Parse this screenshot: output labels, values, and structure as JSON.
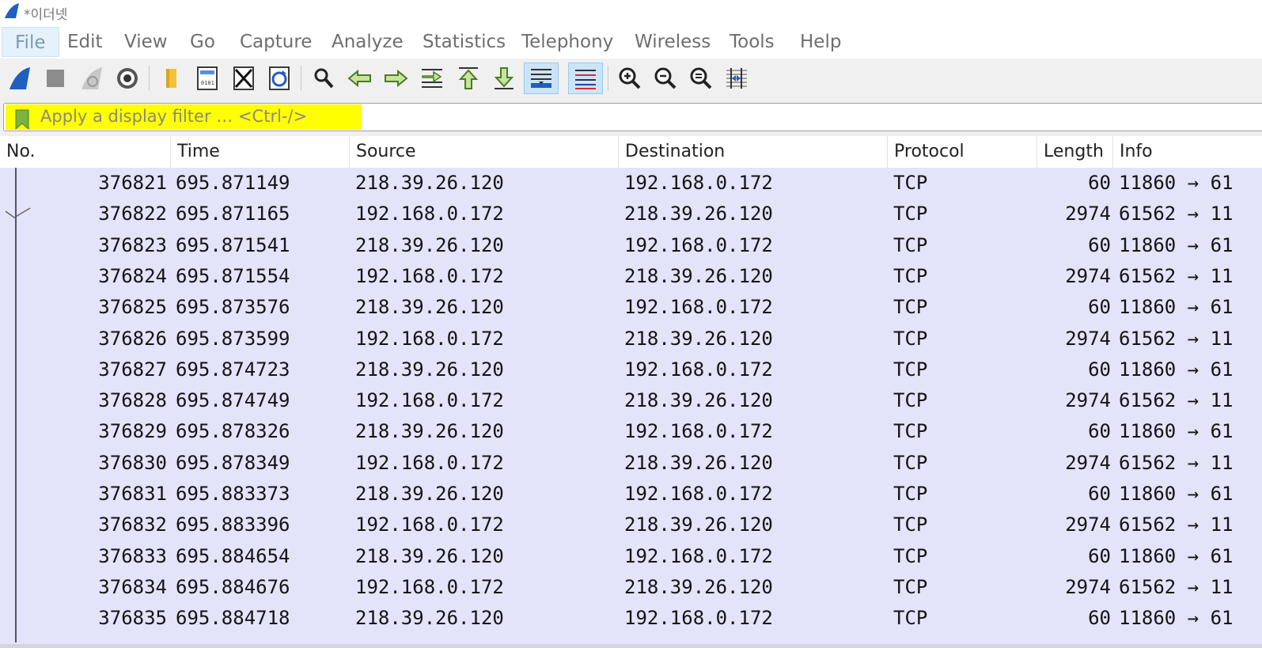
{
  "window": {
    "title": "*이더넷"
  },
  "menu": {
    "items": [
      "File",
      "Edit",
      "View",
      "Go",
      "Capture",
      "Analyze",
      "Statistics",
      "Telephony",
      "Wireless",
      "Tools",
      "Help"
    ]
  },
  "toolbar": {
    "buttons": [
      "start-capture-icon",
      "stop-capture-icon",
      "restart-capture-icon",
      "capture-options-icon",
      "open-file-icon",
      "save-file-icon",
      "close-file-icon",
      "reload-file-icon",
      "find-packet-icon",
      "go-back-icon",
      "go-forward-icon",
      "go-to-packet-icon",
      "go-first-packet-icon",
      "go-last-packet-icon",
      "auto-scroll-icon",
      "colorize-icon",
      "zoom-in-icon",
      "zoom-out-icon",
      "normal-size-icon",
      "resize-columns-icon"
    ],
    "pressed": [
      "auto-scroll-icon",
      "colorize-icon"
    ]
  },
  "filter": {
    "placeholder": "Apply a display filter … <Ctrl-/>",
    "highlight_color": "#ffff00"
  },
  "colors": {
    "row_bg": "#e3e3fa",
    "bookmark": "#7cb342",
    "accent_blue": "#1f5fbf"
  },
  "packet_list": {
    "columns": [
      "No.",
      "Time",
      "Source",
      "Destination",
      "Protocol",
      "Length",
      "Info"
    ],
    "rows": [
      [
        "376821",
        "695.871149",
        "218.39.26.120",
        "192.168.0.172",
        "TCP",
        "60",
        "11860 → 61"
      ],
      [
        "376822",
        "695.871165",
        "192.168.0.172",
        "218.39.26.120",
        "TCP",
        "2974",
        "61562 → 11"
      ],
      [
        "376823",
        "695.871541",
        "218.39.26.120",
        "192.168.0.172",
        "TCP",
        "60",
        "11860 → 61"
      ],
      [
        "376824",
        "695.871554",
        "192.168.0.172",
        "218.39.26.120",
        "TCP",
        "2974",
        "61562 → 11"
      ],
      [
        "376825",
        "695.873576",
        "218.39.26.120",
        "192.168.0.172",
        "TCP",
        "60",
        "11860 → 61"
      ],
      [
        "376826",
        "695.873599",
        "192.168.0.172",
        "218.39.26.120",
        "TCP",
        "2974",
        "61562 → 11"
      ],
      [
        "376827",
        "695.874723",
        "218.39.26.120",
        "192.168.0.172",
        "TCP",
        "60",
        "11860 → 61"
      ],
      [
        "376828",
        "695.874749",
        "192.168.0.172",
        "218.39.26.120",
        "TCP",
        "2974",
        "61562 → 11"
      ],
      [
        "376829",
        "695.878326",
        "218.39.26.120",
        "192.168.0.172",
        "TCP",
        "60",
        "11860 → 61"
      ],
      [
        "376830",
        "695.878349",
        "192.168.0.172",
        "218.39.26.120",
        "TCP",
        "2974",
        "61562 → 11"
      ],
      [
        "376831",
        "695.883373",
        "218.39.26.120",
        "192.168.0.172",
        "TCP",
        "60",
        "11860 → 61"
      ],
      [
        "376832",
        "695.883396",
        "192.168.0.172",
        "218.39.26.120",
        "TCP",
        "2974",
        "61562 → 11"
      ],
      [
        "376833",
        "695.884654",
        "218.39.26.120",
        "192.168.0.172",
        "TCP",
        "60",
        "11860 → 61"
      ],
      [
        "376834",
        "695.884676",
        "192.168.0.172",
        "218.39.26.120",
        "TCP",
        "2974",
        "61562 → 11"
      ],
      [
        "376835",
        "695.884718",
        "218.39.26.120",
        "192.168.0.172",
        "TCP",
        "60",
        "11860 → 61"
      ]
    ]
  }
}
